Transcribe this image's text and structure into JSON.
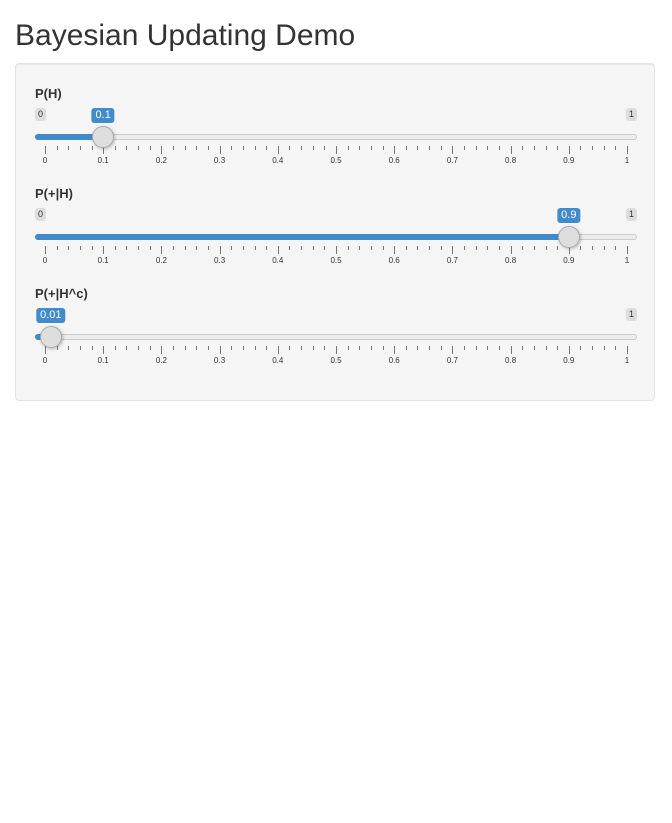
{
  "page": {
    "title": "Bayesian Updating Demo"
  },
  "sliders": [
    {
      "id": "p-h",
      "label": "P(H)",
      "min": 0,
      "max": 1,
      "value": 0.1,
      "value_label": "0.1",
      "min_label": "0",
      "max_label": "1",
      "show_min_label": true
    },
    {
      "id": "p-plus-h",
      "label": "P(+|H)",
      "min": 0,
      "max": 1,
      "value": 0.9,
      "value_label": "0.9",
      "min_label": "0",
      "max_label": "1",
      "show_min_label": true
    },
    {
      "id": "p-plus-hc",
      "label": "P(+|H^c)",
      "min": 0,
      "max": 1,
      "value": 0.01,
      "value_label": "0.01",
      "min_label": "0",
      "max_label": "1",
      "show_min_label": false
    }
  ],
  "tick_labels": [
    "0",
    "0.1",
    "0.2",
    "0.3",
    "0.4",
    "0.5",
    "0.6",
    "0.7",
    "0.8",
    "0.9",
    "1"
  ],
  "colors": {
    "accent": "#428bca",
    "well_bg": "#f5f5f5"
  }
}
